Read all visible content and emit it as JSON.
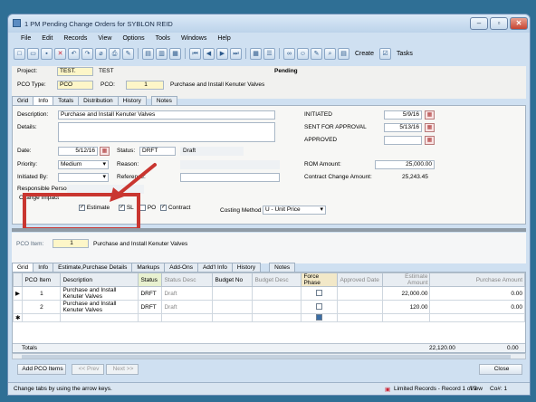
{
  "window": {
    "title": "1 PM Pending Change Orders for SYBLON REID"
  },
  "menu": [
    "File",
    "Edit",
    "Records",
    "View",
    "Options",
    "Tools",
    "Windows",
    "Help"
  ],
  "toolbar": {
    "create_label": "Create",
    "tasks_label": "Tasks"
  },
  "header": {
    "project_label": "Project:",
    "project_value": "TEST.",
    "project_name": "TEST",
    "pco_type_label": "PCO Type:",
    "pco_type_value": "PCO",
    "pco_label": "PCO:",
    "pco_value": "1",
    "pco_desc": "Purchase and Install Kenuter Valves",
    "status": "Pending"
  },
  "top_tabs": [
    "Grid",
    "Info",
    "Totals",
    "Distribution",
    "History",
    "Notes"
  ],
  "info": {
    "description_label": "Description:",
    "description_value": "Purchase and Install Kenuter Valves",
    "details_label": "Details:",
    "date_label": "Date:",
    "date_value": "5/12/16",
    "status_label": "Status:",
    "status_code": "DRFT",
    "status_text": "Draft",
    "priority_label": "Priority:",
    "priority_value": "Medium",
    "reason_label": "Reason:",
    "initiated_by_label": "Initiated By:",
    "reference_label": "Reference:",
    "responsible_label": "Responsible Person:",
    "initiated_label": "INITIATED",
    "initiated_value": "5/9/16",
    "sent_label": "SENT FOR APPROVAL",
    "sent_value": "5/13/16",
    "approved_label": "APPROVED",
    "rom_label": "ROM Amount:",
    "rom_value": "25,000.00",
    "contract_label": "Contract Change Amount:",
    "contract_value": "25,243.45",
    "change_impact_label": "Change Impact",
    "estimate_label": "Estimate",
    "sl_label": "SL",
    "po_label": "PO",
    "contract_cb_label": "Contract",
    "costing_label": "Costing Method",
    "costing_value": "U - Unit Price"
  },
  "item_bar": {
    "label": "PCO Item:",
    "value": "1",
    "desc": "Purchase and Install Kenuter Valves"
  },
  "bottom_tabs": [
    "Grid",
    "Info",
    "Estimate,Purchase Details",
    "Markups",
    "Add-Ons",
    "Add'l Info",
    "History",
    "Notes"
  ],
  "grid": {
    "columns": [
      "PCO Item",
      "Description",
      "Status",
      "Status Desc",
      "Budget No",
      "Budget Desc",
      "Force Phase",
      "Approved Date",
      "Estimate Amount",
      "Purchase Amount"
    ],
    "rows": [
      [
        "1",
        "Purchase and Install Kenuter Valves",
        "DRFT",
        "Draft",
        "",
        "",
        "",
        "",
        "22,000.00",
        "0.00"
      ],
      [
        "2",
        "Purchase and Install Kenuter Valves",
        "DRFT",
        "Draft",
        "",
        "",
        "",
        "",
        "120.00",
        "0.00"
      ]
    ],
    "totals_label": "Totals",
    "totals_estimate": "22,120.00",
    "totals_purchase": "0.00"
  },
  "buttons": {
    "add_items": "Add PCO Items",
    "prev": "<< Prev",
    "next": "Next >>",
    "close": "Close"
  },
  "statusbar": {
    "hint": "Change tabs by using the arrow keys.",
    "limited": "Limited Records - Record 1 of 2",
    "view": "View",
    "co": "Co#: 1"
  },
  "colors": {
    "highlight_red": "#c93630",
    "field_yellow": "#fdf6c8"
  }
}
